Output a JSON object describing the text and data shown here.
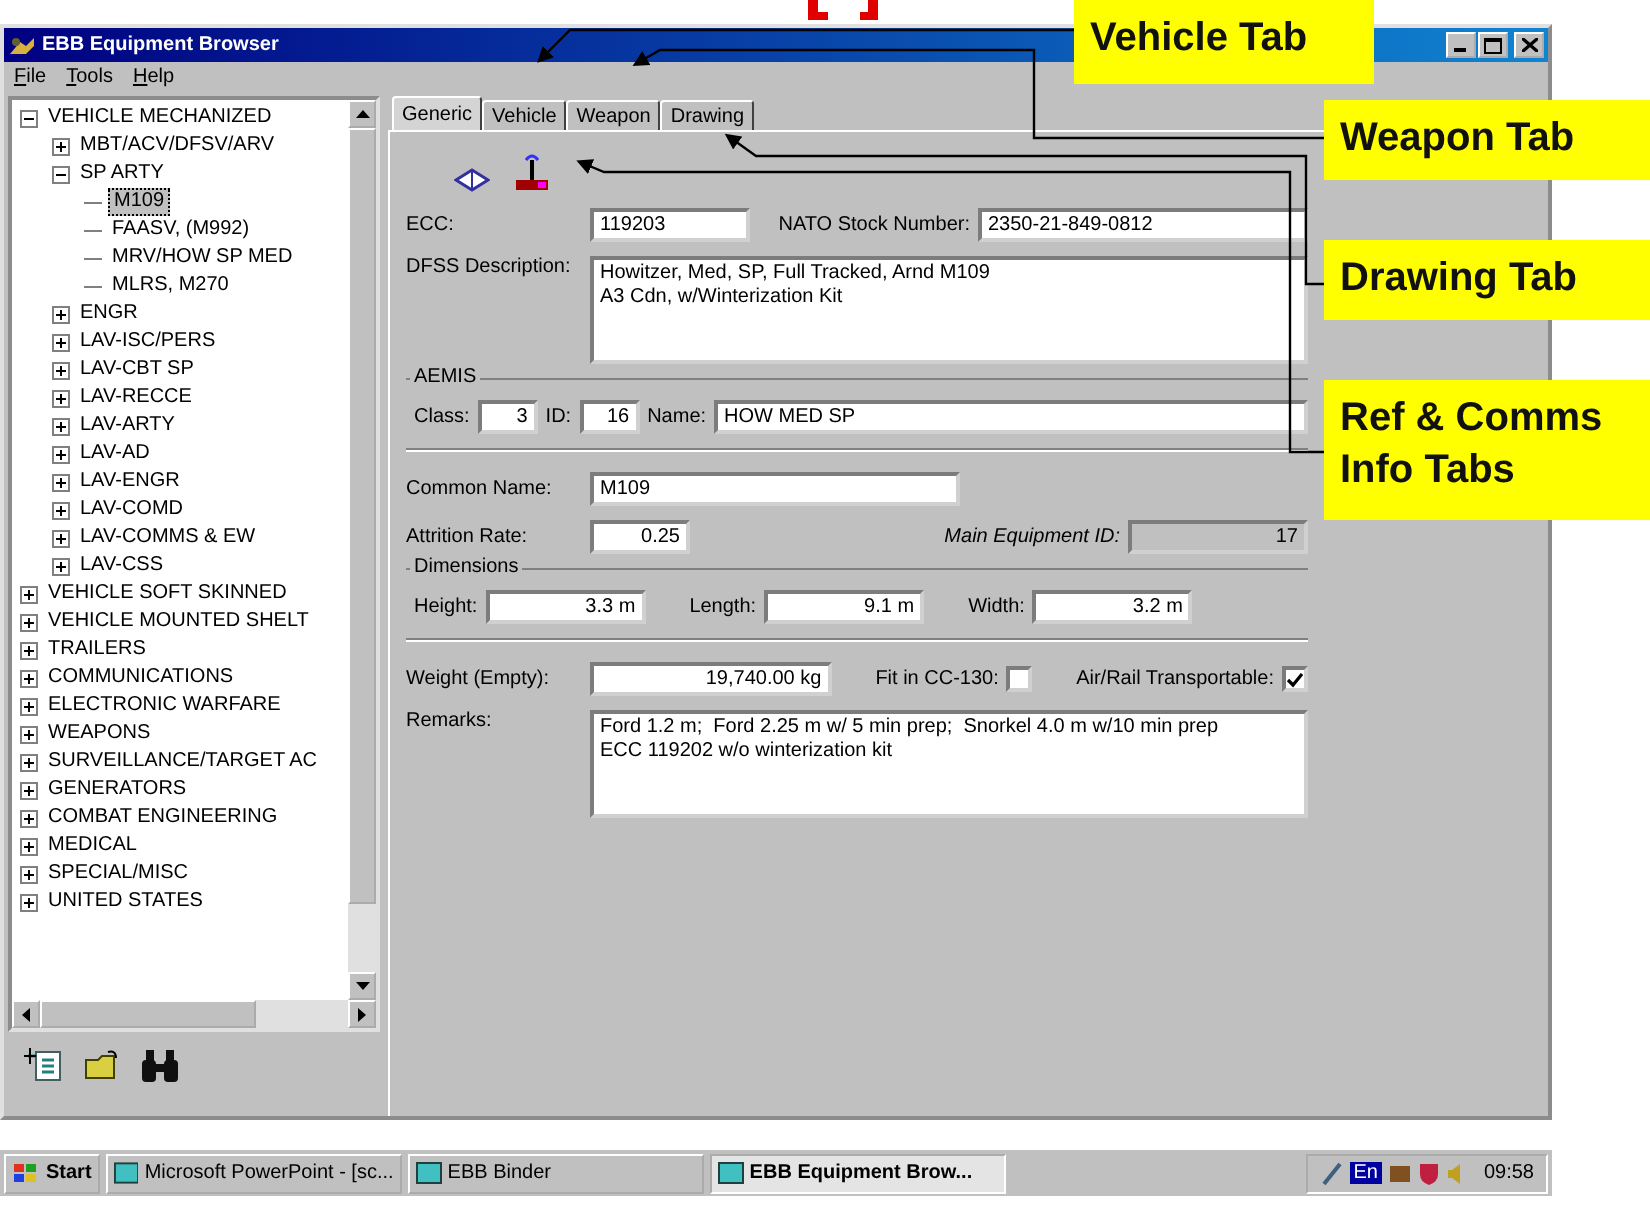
{
  "window": {
    "title": "EBB Equipment Browser"
  },
  "menu": [
    "File",
    "Tools",
    "Help"
  ],
  "tree": {
    "items": [
      {
        "label": "VEHICLE MECHANIZED",
        "expanded": true,
        "selected": false,
        "children": [
          {
            "label": "MBT/ACV/DFSV/ARV",
            "expanded": false,
            "selected": false
          },
          {
            "label": "SP ARTY",
            "expanded": true,
            "selected": false,
            "children": [
              {
                "label": "M109",
                "selected": true
              },
              {
                "label": "FAASV, (M992)",
                "selected": false
              },
              {
                "label": "MRV/HOW SP MED",
                "selected": false
              },
              {
                "label": "MLRS, M270",
                "selected": false
              }
            ]
          },
          {
            "label": "ENGR",
            "expanded": false,
            "selected": false
          },
          {
            "label": "LAV-ISC/PERS",
            "expanded": false,
            "selected": false
          },
          {
            "label": "LAV-CBT SP",
            "expanded": false,
            "selected": false
          },
          {
            "label": "LAV-RECCE",
            "expanded": false,
            "selected": false
          },
          {
            "label": "LAV-ARTY",
            "expanded": false,
            "selected": false
          },
          {
            "label": "LAV-AD",
            "expanded": false,
            "selected": false
          },
          {
            "label": "LAV-ENGR",
            "expanded": false,
            "selected": false
          },
          {
            "label": "LAV-COMD",
            "expanded": false,
            "selected": false
          },
          {
            "label": "LAV-COMMS & EW",
            "expanded": false,
            "selected": false
          },
          {
            "label": "LAV-CSS",
            "expanded": false,
            "selected": false
          }
        ]
      },
      {
        "label": "VEHICLE SOFT SKINNED",
        "expanded": false,
        "selected": false
      },
      {
        "label": "VEHICLE MOUNTED SHELT",
        "expanded": false,
        "selected": false
      },
      {
        "label": "TRAILERS",
        "expanded": false,
        "selected": false
      },
      {
        "label": "COMMUNICATIONS",
        "expanded": false,
        "selected": false
      },
      {
        "label": "ELECTRONIC WARFARE",
        "expanded": false,
        "selected": false
      },
      {
        "label": "WEAPONS",
        "expanded": false,
        "selected": false
      },
      {
        "label": "SURVEILLANCE/TARGET AC",
        "expanded": false,
        "selected": false
      },
      {
        "label": "GENERATORS",
        "expanded": false,
        "selected": false
      },
      {
        "label": "COMBAT ENGINEERING",
        "expanded": false,
        "selected": false
      },
      {
        "label": "MEDICAL",
        "expanded": false,
        "selected": false
      },
      {
        "label": "SPECIAL/MISC",
        "expanded": false,
        "selected": false
      },
      {
        "label": "UNITED STATES",
        "expanded": false,
        "selected": false
      }
    ]
  },
  "tabs": [
    {
      "label": "Generic",
      "selected": true
    },
    {
      "label": "Vehicle",
      "selected": false
    },
    {
      "label": "Weapon",
      "selected": false
    },
    {
      "label": "Drawing",
      "selected": false
    }
  ],
  "form": {
    "ecc": {
      "label": "ECC:",
      "value": "119203"
    },
    "nato_stock_number": {
      "label": "NATO Stock Number:",
      "value": "2350-21-849-0812"
    },
    "description": {
      "label": "DFSS Description:",
      "lines": [
        "Howitzer, Med, SP, Full Tracked, Arnd M109",
        "A3 Cdn, w/Winterization Kit"
      ]
    },
    "aemis": {
      "title": "AEMIS",
      "class": {
        "label": "Class:",
        "value": "3"
      },
      "id": {
        "label": "ID:",
        "value": "16"
      },
      "name": {
        "label": "Name:",
        "value": "HOW MED SP"
      }
    },
    "common_name": {
      "label": "Common Name:",
      "value": "M109"
    },
    "attrition_rate": {
      "label": "Attrition Rate:",
      "value": "0.25"
    },
    "main_equipment_id": {
      "label": "Main Equipment ID:",
      "value": "17",
      "disabled": true
    },
    "dimensions": {
      "title": "Dimensions",
      "height": {
        "label": "Height:",
        "value": "3.3 m"
      },
      "length": {
        "label": "Length:",
        "value": "9.1 m"
      },
      "width": {
        "label": "Width:",
        "value": "3.2 m"
      }
    },
    "weight": {
      "label": "Weight (Empty):",
      "value": "19,740.00 kg"
    },
    "fit_in_cc130": {
      "label": "Fit in CC-130:",
      "checked": false
    },
    "air_rail": {
      "label": "Air/Rail Transportable:",
      "checked": true
    },
    "remarks": {
      "label": "Remarks:",
      "lines": [
        "Ford 1.2 m;  Ford 2.25 m w/ 5 min prep;  Snorkel 4.0 m w/10 min prep",
        "ECC 119202 w/o winterization kit"
      ]
    }
  },
  "taskbar": {
    "start": "Start",
    "tasks": [
      {
        "label": "Microsoft PowerPoint - [sc...",
        "selected": false
      },
      {
        "label": "EBB Binder",
        "selected": false
      },
      {
        "label": "EBB Equipment Brow...",
        "selected": true
      }
    ],
    "tray": {
      "language": "En",
      "clock": "09:58"
    }
  },
  "callouts": [
    {
      "label": "Vehicle Tab"
    },
    {
      "label": "Weapon Tab"
    },
    {
      "label": "Drawing Tab"
    },
    {
      "label": "Ref & Comms Info Tabs"
    }
  ]
}
